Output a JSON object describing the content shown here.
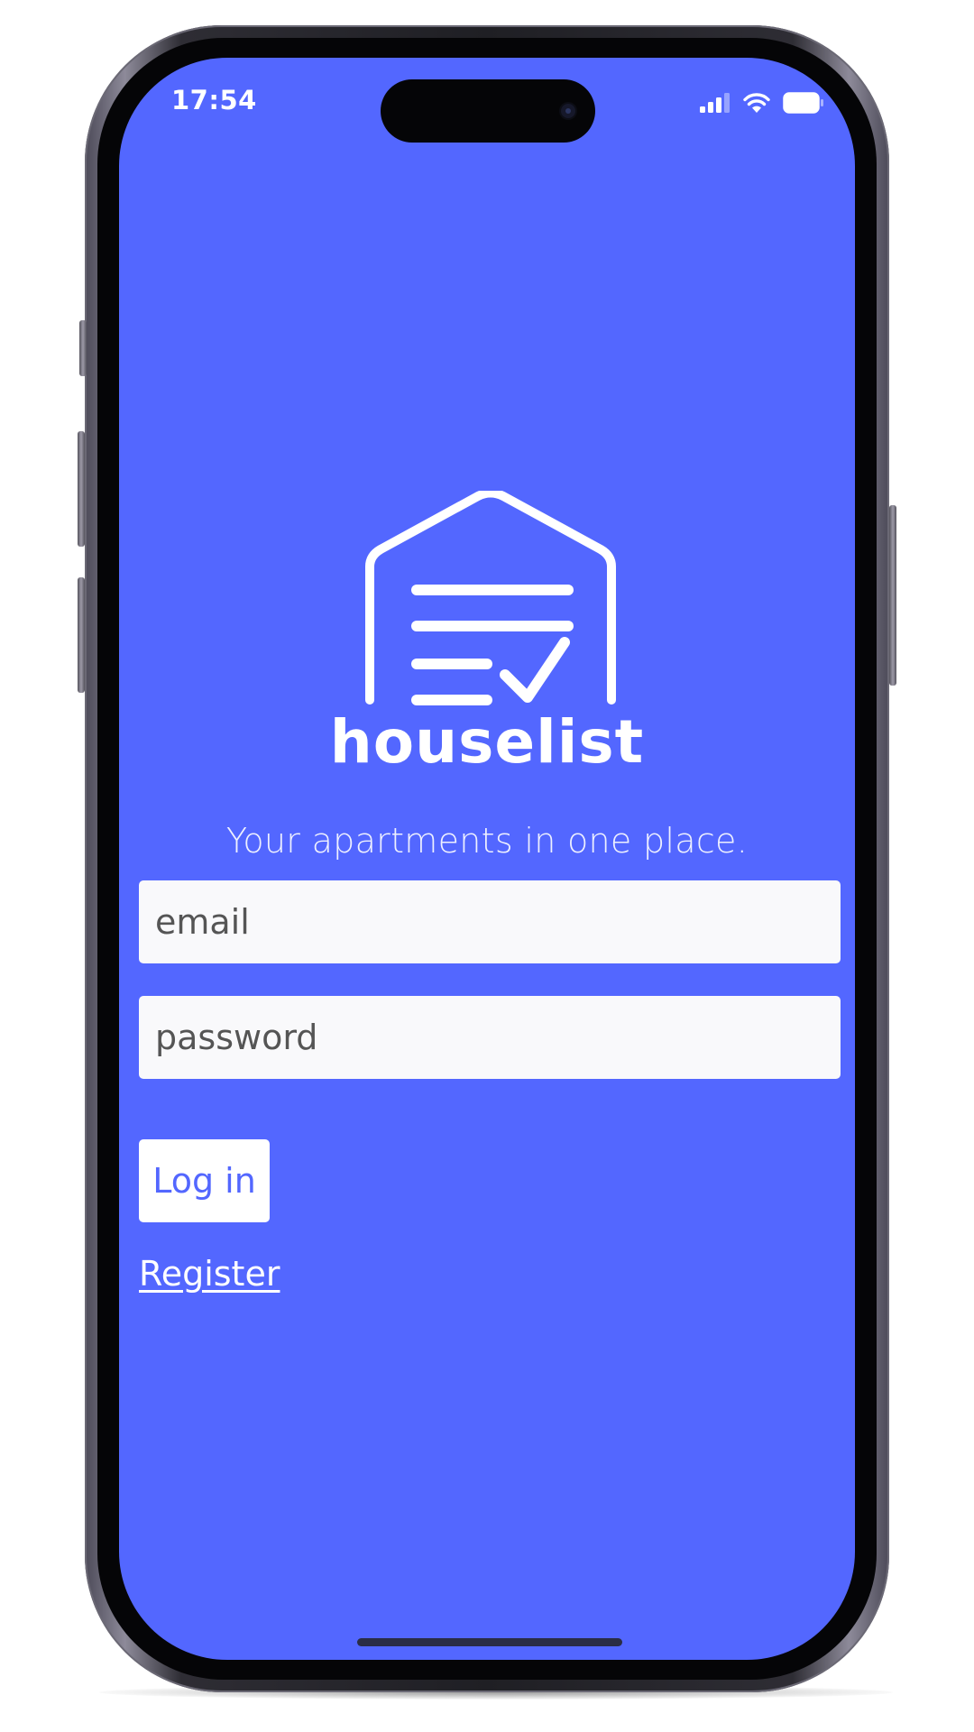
{
  "status_bar": {
    "time": "17:54",
    "icons": [
      "cellular-signal-icon",
      "wifi-icon",
      "battery-icon"
    ]
  },
  "app": {
    "logo_text": "houselist",
    "logo_icon": "house-checklist-logo",
    "tagline": "Your apartments in one place."
  },
  "login_form": {
    "email_placeholder": "email",
    "password_placeholder": "password",
    "login_label": "Log in",
    "register_label": "Register"
  },
  "colors": {
    "background": "#5367ff",
    "field_background": "#f9f9fb",
    "button_text": "#5367ff",
    "text_light": "#ffffff"
  }
}
